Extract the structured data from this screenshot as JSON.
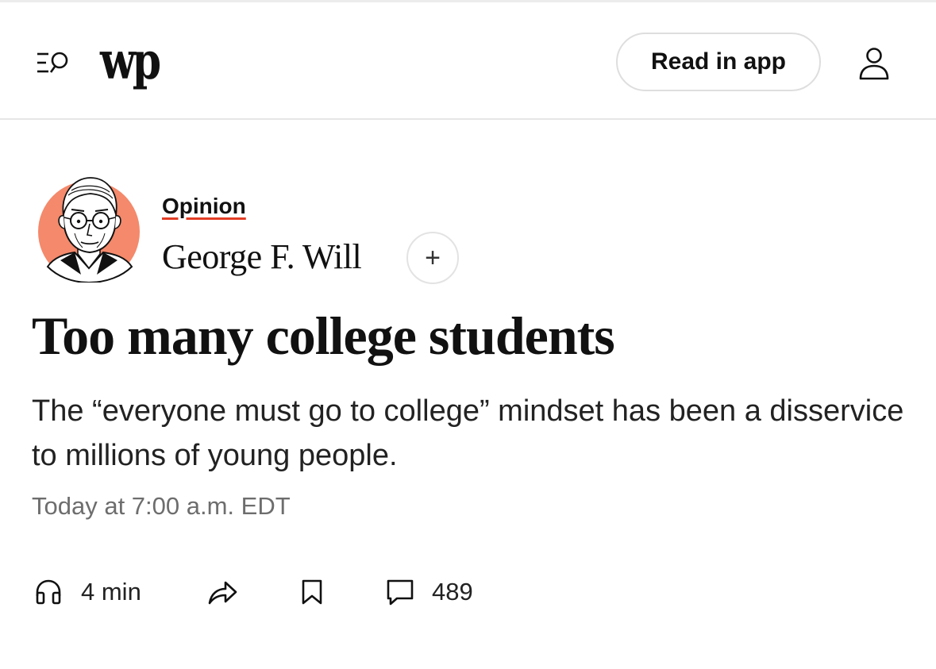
{
  "header": {
    "logo_text": "wp",
    "read_in_app_label": "Read in app",
    "icons": {
      "menu": "menu-search-icon",
      "account": "person-icon"
    }
  },
  "article": {
    "section": "Opinion",
    "author": "George F. Will",
    "follow_label": "+",
    "headline": "Too many college students",
    "dek": "The “everyone must go to college” mindset has been a disservice to millions of young people.",
    "timestamp": "Today at 7:00 a.m. EDT"
  },
  "actions": {
    "listen_duration": "4 min",
    "comment_count": "489",
    "icons": [
      "headphones-icon",
      "share-icon",
      "bookmark-icon",
      "comment-icon"
    ]
  },
  "colors": {
    "accent_underline": "#e23e26",
    "avatar_bg": "#f4896b",
    "muted_text": "#6d6d6d",
    "border": "#e6e6e6"
  }
}
